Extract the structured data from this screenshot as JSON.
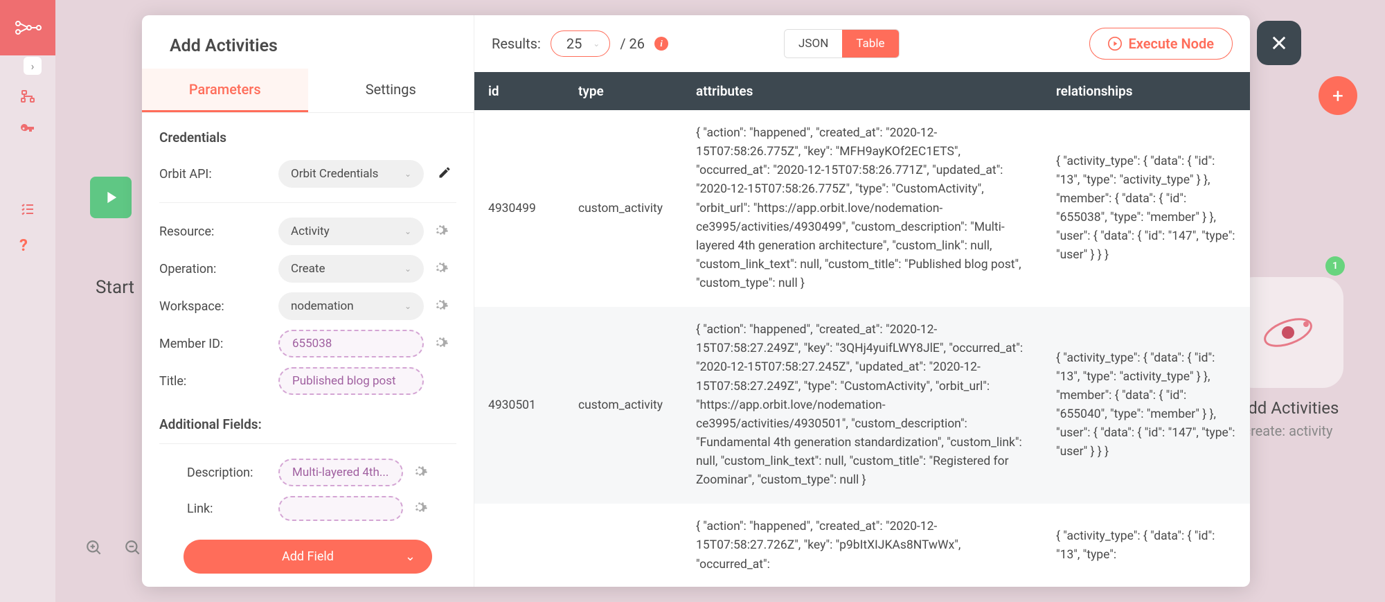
{
  "bg": {
    "start_label": "Start",
    "node_label": "Add Activities",
    "node_sublabel": "create: activity",
    "node_badge": "1"
  },
  "panel": {
    "title": "Add Activities",
    "tabs": {
      "parameters": "Parameters",
      "settings": "Settings"
    },
    "credentials_header": "Credentials",
    "orbit_api_label": "Orbit API:",
    "orbit_api_value": "Orbit Credentials",
    "fields": {
      "resource": {
        "label": "Resource:",
        "value": "Activity"
      },
      "operation": {
        "label": "Operation:",
        "value": "Create"
      },
      "workspace": {
        "label": "Workspace:",
        "value": "nodemation"
      },
      "member_id": {
        "label": "Member ID:",
        "value": "655038"
      },
      "title": {
        "label": "Title:",
        "value": "Published blog post"
      }
    },
    "additional_header": "Additional Fields:",
    "additional": {
      "description": {
        "label": "Description:",
        "value": "Multi-layered 4th..."
      },
      "link": {
        "label": "Link:",
        "value": ""
      }
    },
    "add_field_label": "Add Field"
  },
  "results": {
    "label": "Results:",
    "count": "25",
    "of": "/ 26",
    "json_label": "JSON",
    "table_label": "Table",
    "execute_label": "Execute Node"
  },
  "table": {
    "headers": {
      "id": "id",
      "type": "type",
      "attributes": "attributes",
      "relationships": "relationships"
    },
    "rows": [
      {
        "id": "4930499",
        "type": "custom_activity",
        "attributes": "{ \"action\": \"happened\", \"created_at\": \"2020-12-15T07:58:26.775Z\", \"key\": \"MFH9ayKOf2EC1ETS\", \"occurred_at\": \"2020-12-15T07:58:26.771Z\", \"updated_at\": \"2020-12-15T07:58:26.775Z\", \"type\": \"CustomActivity\", \"orbit_url\": \"https://app.orbit.love/nodemation-ce3995/activities/4930499\", \"custom_description\": \"Multi-layered 4th generation architecture\", \"custom_link\": null, \"custom_link_text\": null, \"custom_title\": \"Published blog post\", \"custom_type\": null }",
        "relationships": "{ \"activity_type\": { \"data\": { \"id\": \"13\", \"type\": \"activity_type\" } }, \"member\": { \"data\": { \"id\": \"655038\", \"type\": \"member\" } }, \"user\": { \"data\": { \"id\": \"147\", \"type\": \"user\" } } }"
      },
      {
        "id": "4930501",
        "type": "custom_activity",
        "attributes": "{ \"action\": \"happened\", \"created_at\": \"2020-12-15T07:58:27.249Z\", \"key\": \"3QHj4yuifLWY8JlE\", \"occurred_at\": \"2020-12-15T07:58:27.245Z\", \"updated_at\": \"2020-12-15T07:58:27.249Z\", \"type\": \"CustomActivity\", \"orbit_url\": \"https://app.orbit.love/nodemation-ce3995/activities/4930501\", \"custom_description\": \"Fundamental 4th generation standardization\", \"custom_link\": null, \"custom_link_text\": null, \"custom_title\": \"Registered for Zoominar\", \"custom_type\": null }",
        "relationships": "{ \"activity_type\": { \"data\": { \"id\": \"13\", \"type\": \"activity_type\" } }, \"member\": { \"data\": { \"id\": \"655040\", \"type\": \"member\" } }, \"user\": { \"data\": { \"id\": \"147\", \"type\": \"user\" } } }"
      },
      {
        "id": "",
        "type": "",
        "attributes": "{ \"action\": \"happened\", \"created_at\": \"2020-12-15T07:58:27.726Z\", \"key\": \"p9bItXIJKAs8NTwWx\", \"occurred_at\":",
        "relationships": "{ \"activity_type\": { \"data\": { \"id\": \"13\", \"type\":"
      }
    ]
  }
}
